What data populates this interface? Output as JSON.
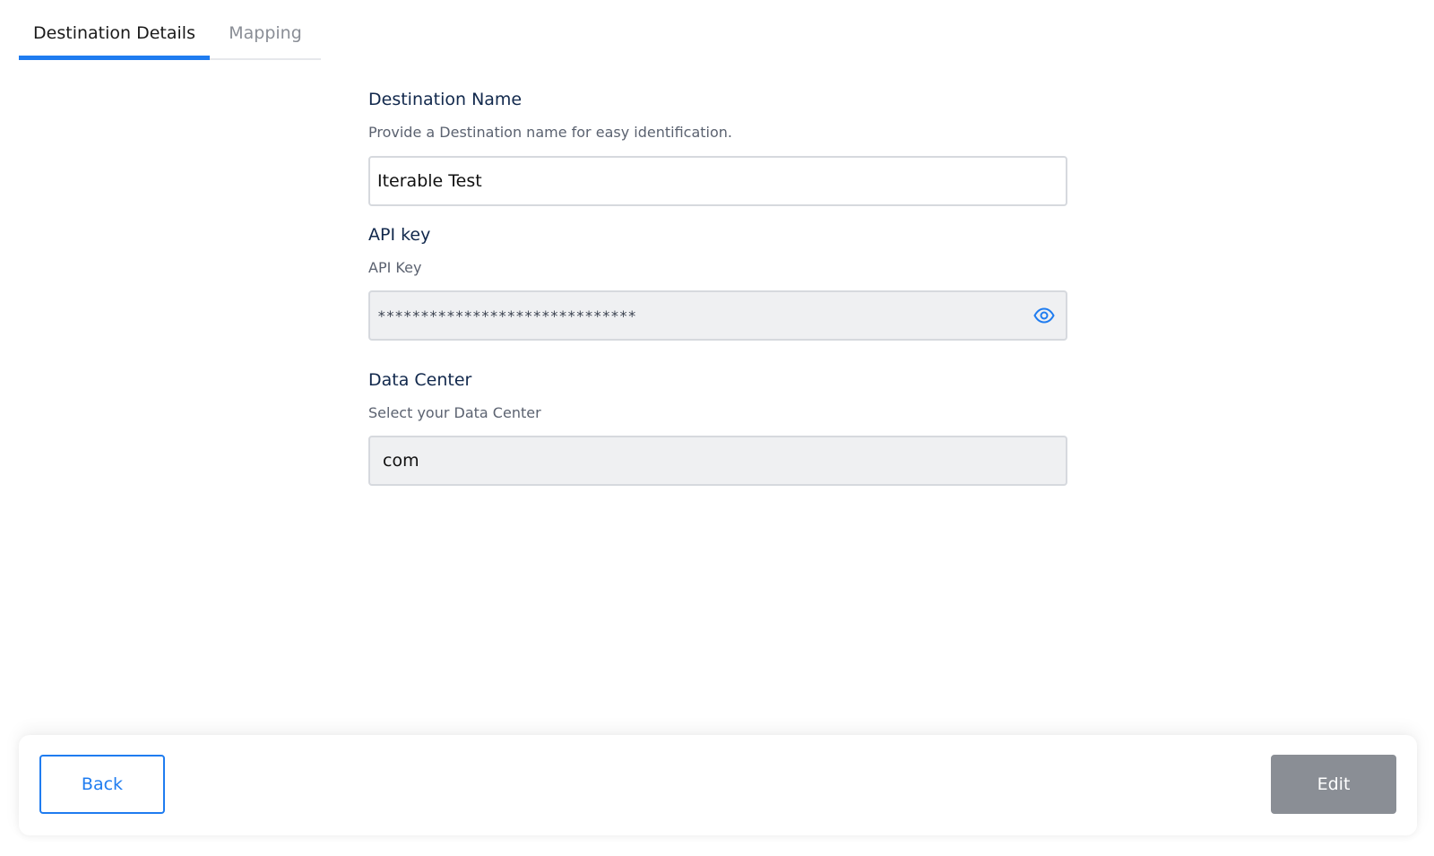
{
  "tabs": {
    "details": "Destination Details",
    "mapping": "Mapping"
  },
  "form": {
    "destination_name": {
      "title": "Destination Name",
      "help": "Provide a Destination name for easy identification.",
      "value": "Iterable Test"
    },
    "api_key": {
      "title": "API key",
      "help": "API Key",
      "value": "******************************"
    },
    "data_center": {
      "title": "Data Center",
      "help": "Select your Data Center",
      "value": "com"
    }
  },
  "footer": {
    "back_label": "Back",
    "edit_label": "Edit"
  },
  "colors": {
    "accent": "#1f7cf0",
    "heading": "#11284c",
    "disabled_button": "#8a8e95"
  },
  "icons": {
    "reveal": "eye-icon"
  }
}
